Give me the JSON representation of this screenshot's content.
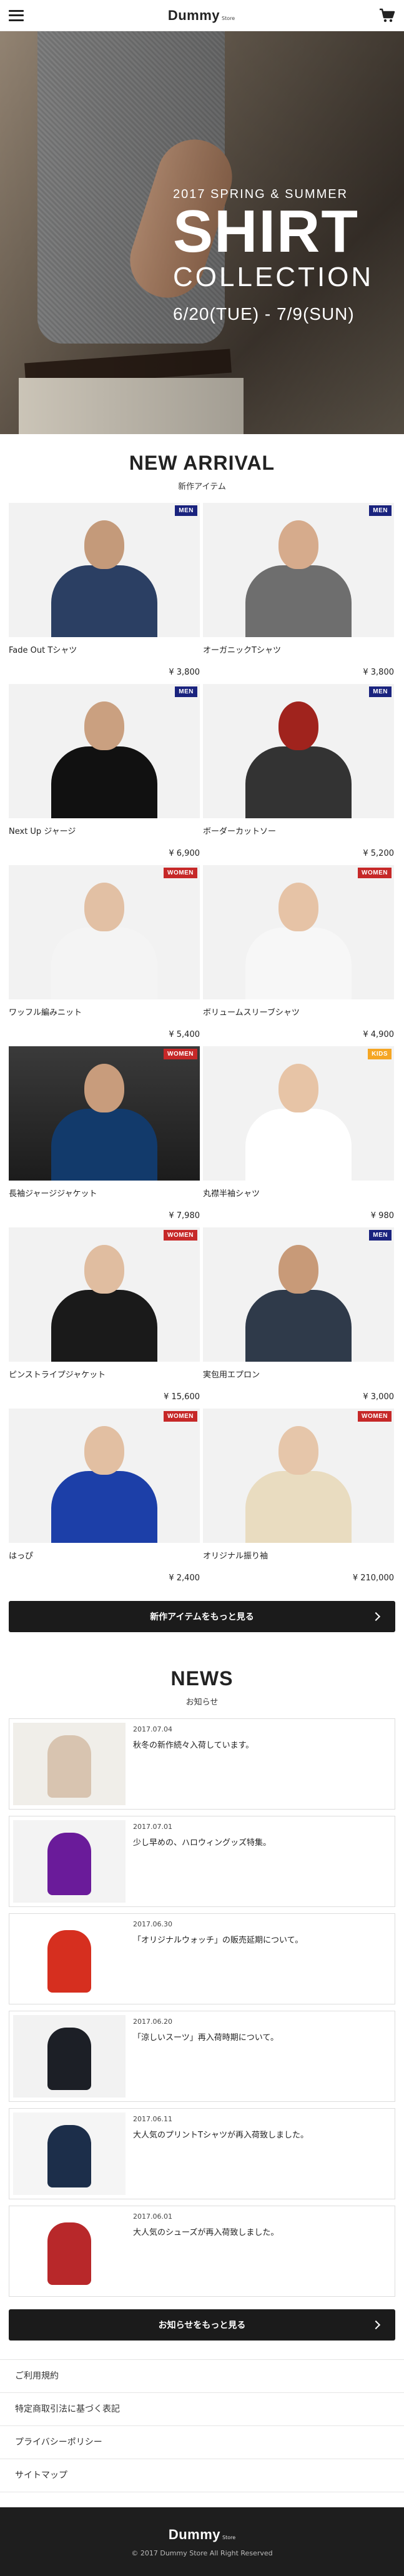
{
  "header": {
    "logo": "Dummy",
    "logo_sub": "Store"
  },
  "hero": {
    "subtitle": "2017 SPRING & SUMMER",
    "title": "SHIRT",
    "title2": "COLLECTION",
    "date": "6/20(TUE) - 7/9(SUN)"
  },
  "arrival": {
    "title": "NEW ARRIVAL",
    "subtitle": "新作アイテム",
    "more_button": "新作アイテムをもっと見る",
    "items": [
      {
        "name": "Fade Out Tシャツ",
        "price": "¥ 3,800",
        "badge": "MEN",
        "badge_color": "#1a237e",
        "skin": "#c49a7a",
        "top": "#2b3f63",
        "dark": false
      },
      {
        "name": "オーガニックTシャツ",
        "price": "¥ 3,800",
        "badge": "MEN",
        "badge_color": "#1a237e",
        "skin": "#d6ab8c",
        "top": "#6e6e6e",
        "dark": false
      },
      {
        "name": "Next Up ジャージ",
        "price": "¥ 6,900",
        "badge": "MEN",
        "badge_color": "#1a237e",
        "skin": "#caa080",
        "top": "#111111",
        "dark": false
      },
      {
        "name": "ボーダーカットソー",
        "price": "¥ 5,200",
        "badge": "MEN",
        "badge_color": "#1a237e",
        "skin": "#a0231d",
        "top": "#333333",
        "dark": false
      },
      {
        "name": "ワッフル編みニット",
        "price": "¥ 5,400",
        "badge": "WOMEN",
        "badge_color": "#c62828",
        "skin": "#e2c0a4",
        "top": "#f4f4f4",
        "dark": false
      },
      {
        "name": "ボリュームスリーブシャツ",
        "price": "¥ 4,900",
        "badge": "WOMEN",
        "badge_color": "#c62828",
        "skin": "#e6c3a6",
        "top": "#f7f7f7",
        "dark": false
      },
      {
        "name": "長袖ジャージジャケット",
        "price": "¥ 7,980",
        "badge": "WOMEN",
        "badge_color": "#c62828",
        "skin": "#c89c7c",
        "top": "#123a6b",
        "dark": true
      },
      {
        "name": "丸襟半袖シャツ",
        "price": "¥ 980",
        "badge": "KIDS",
        "badge_color": "#f5a623",
        "skin": "#e7c4a6",
        "top": "#ffffff",
        "dark": false
      },
      {
        "name": "ピンストライプジャケット",
        "price": "¥ 15,600",
        "badge": "WOMEN",
        "badge_color": "#c62828",
        "skin": "#e0bda0",
        "top": "#1a1a1a",
        "dark": false
      },
      {
        "name": "実包用エプロン",
        "price": "¥ 3,000",
        "badge": "MEN",
        "badge_color": "#1a237e",
        "skin": "#c89a78",
        "top": "#2f3a4a",
        "dark": false
      },
      {
        "name": "はっぴ",
        "price": "¥ 2,400",
        "badge": "WOMEN",
        "badge_color": "#c62828",
        "skin": "#e2bfa2",
        "top": "#1c3fa8",
        "dark": false
      },
      {
        "name": "オリジナル振り袖",
        "price": "¥ 210,000",
        "badge": "WOMEN",
        "badge_color": "#c62828",
        "skin": "#e6c6aa",
        "top": "#e9dcc0",
        "dark": false
      }
    ]
  },
  "news": {
    "title": "NEWS",
    "subtitle": "お知らせ",
    "more_button": "お知らせをもっと見る",
    "items": [
      {
        "date": "2017.07.04",
        "title": "秋冬の新作続々入荷しています。",
        "thumb_color": "#d8c4b0",
        "thumb_bg": "#f0eee9"
      },
      {
        "date": "2017.07.01",
        "title": "少し早めの、ハロウィングッズ特集。",
        "thumb_color": "#6a1b9a",
        "thumb_bg": "#f3f3f3"
      },
      {
        "date": "2017.06.30",
        "title": "「オリジナルウォッチ」の販売延期について。",
        "thumb_color": "#d62f1f",
        "thumb_bg": "#ffffff"
      },
      {
        "date": "2017.06.20",
        "title": "「涼しいスーツ」再入荷時期について。",
        "thumb_color": "#1c1f26",
        "thumb_bg": "#f2f2f2"
      },
      {
        "date": "2017.06.11",
        "title": "大人気のプリントTシャツが再入荷致しました。",
        "thumb_color": "#1c2e4a",
        "thumb_bg": "#f5f5f5"
      },
      {
        "date": "2017.06.01",
        "title": "大人気のシューズが再入荷致しました。",
        "thumb_color": "#b8282a",
        "thumb_bg": "#ffffff"
      }
    ]
  },
  "footer": {
    "links": [
      "ご利用規約",
      "特定商取引法に基づく表記",
      "プライバシーポリシー",
      "サイトマップ"
    ],
    "logo": "Dummy",
    "logo_sub": "Store",
    "copyright": "© 2017 Dummy Store All Right Reserved"
  }
}
